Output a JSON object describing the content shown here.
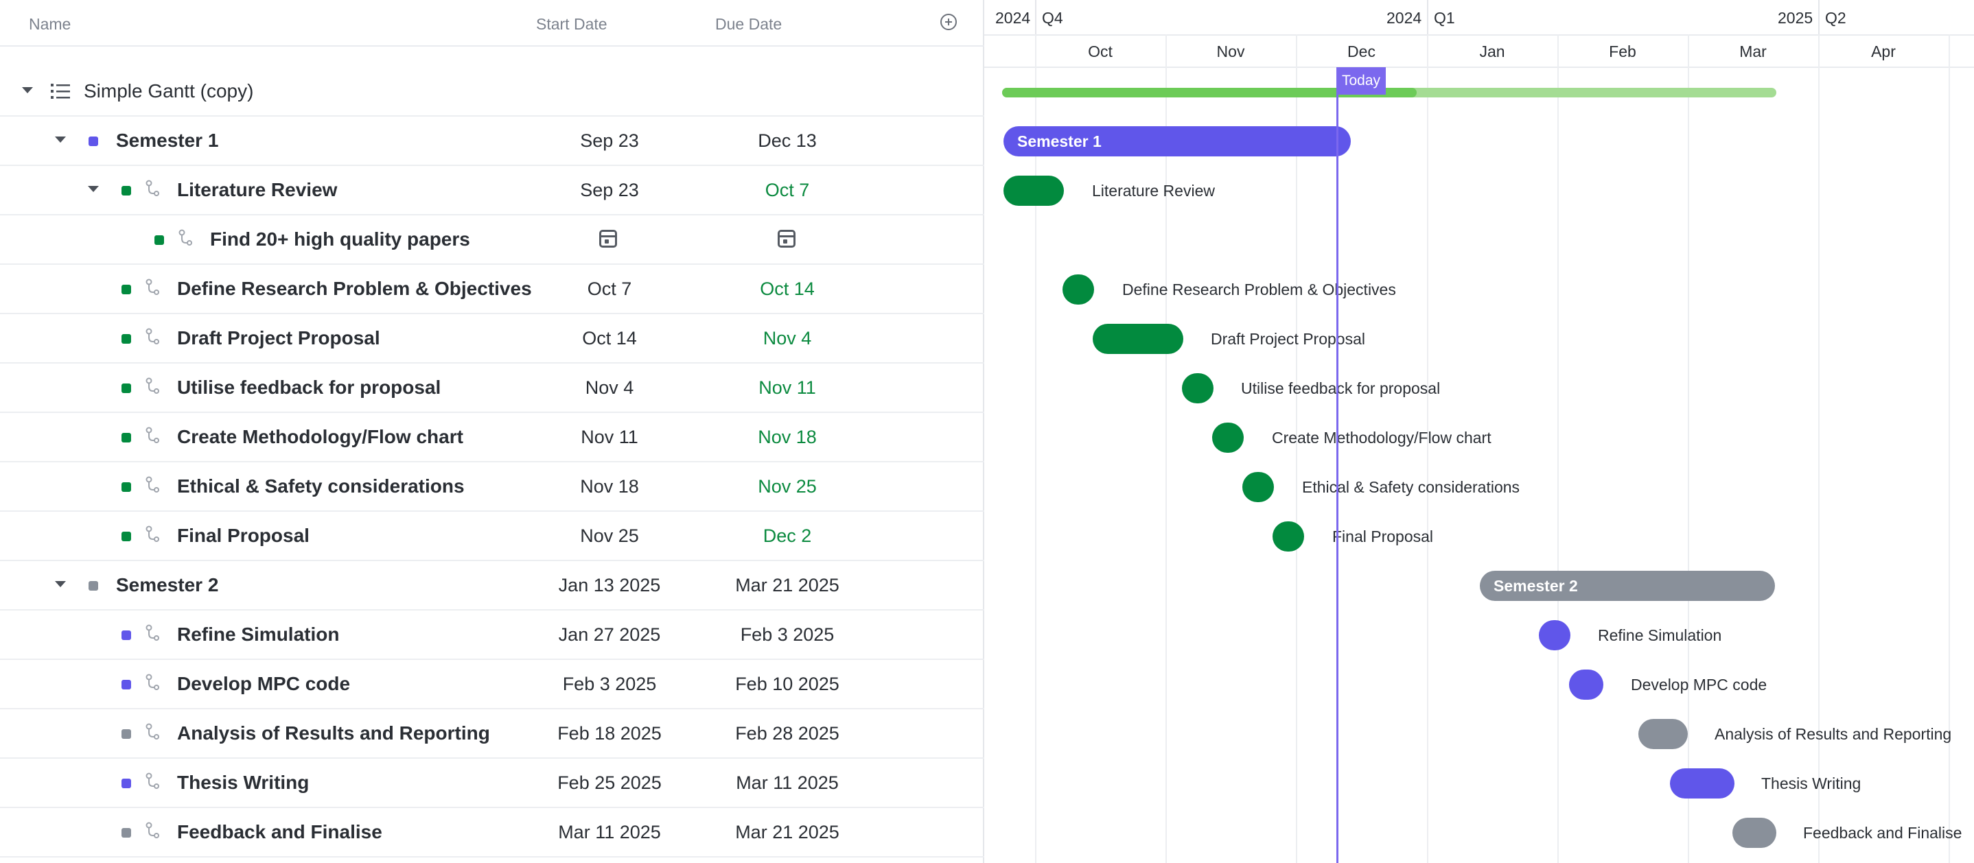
{
  "columns": {
    "name": "Name",
    "start": "Start Date",
    "due": "Due Date"
  },
  "colors": {
    "accent": "#7b68ee",
    "semester1": "#6056ea",
    "green": "#028a3e",
    "grey": "#89909a",
    "progress": "#6ccb57"
  },
  "project": {
    "name": "Simple Gantt (copy)",
    "progress_fraction": 0.54
  },
  "rows": [
    {
      "name": "Semester 1",
      "start": "Sep 23",
      "due": "Dec 13"
    },
    {
      "name": "Literature Review",
      "start": "Sep 23",
      "due": "Oct 7"
    },
    {
      "name": "Find 20+ high quality papers",
      "start": "",
      "due": ""
    },
    {
      "name": "Define Research Problem & Objectives",
      "start": "Oct 7",
      "due": "Oct 14"
    },
    {
      "name": "Draft Project Proposal",
      "start": "Oct 14",
      "due": "Nov 4"
    },
    {
      "name": "Utilise feedback for proposal",
      "start": "Nov 4",
      "due": "Nov 11"
    },
    {
      "name": "Create Methodology/Flow chart",
      "start": "Nov 11",
      "due": "Nov 18"
    },
    {
      "name": "Ethical & Safety considerations",
      "start": "Nov 18",
      "due": "Nov 25"
    },
    {
      "name": "Final Proposal",
      "start": "Nov 25",
      "due": "Dec 2"
    },
    {
      "name": "Semester 2",
      "start": "Jan 13 2025",
      "due": "Mar 21 2025"
    },
    {
      "name": "Refine Simulation",
      "start": "Jan 27 2025",
      "due": "Feb 3 2025"
    },
    {
      "name": "Develop MPC code",
      "start": "Feb 3 2025",
      "due": "Feb 10 2025"
    },
    {
      "name": "Analysis of Results and Reporting",
      "start": "Feb 18 2025",
      "due": "Feb 28 2025"
    },
    {
      "name": "Thesis Writing",
      "start": "Feb 25 2025",
      "due": "Mar 11 2025"
    },
    {
      "name": "Feedback and Finalise",
      "start": "Mar 11 2025",
      "due": "Mar 21 2025"
    }
  ],
  "timeline": {
    "quarters": [
      {
        "year": "2024",
        "q": "Q4"
      },
      {
        "year": "2024",
        "q": "Q1"
      },
      {
        "year": "2025",
        "q": "Q2"
      }
    ],
    "months": [
      "Oct",
      "Nov",
      "Dec",
      "Jan",
      "Feb",
      "Mar",
      "Apr"
    ],
    "today_label": "Today"
  },
  "bars": [
    {
      "label": "Semester 1"
    },
    {
      "label": "Literature Review"
    },
    {
      "label": "Define Research Problem & Objectives"
    },
    {
      "label": "Draft Project Proposal"
    },
    {
      "label": "Utilise feedback for proposal"
    },
    {
      "label": "Create Methodology/Flow chart"
    },
    {
      "label": "Ethical & Safety considerations"
    },
    {
      "label": "Final Proposal"
    },
    {
      "label": "Semester 2"
    },
    {
      "label": "Refine Simulation"
    },
    {
      "label": "Develop MPC code"
    },
    {
      "label": "Analysis of Results and Reporting"
    },
    {
      "label": "Thesis Writing"
    },
    {
      "label": "Feedback and Finalise"
    }
  ]
}
